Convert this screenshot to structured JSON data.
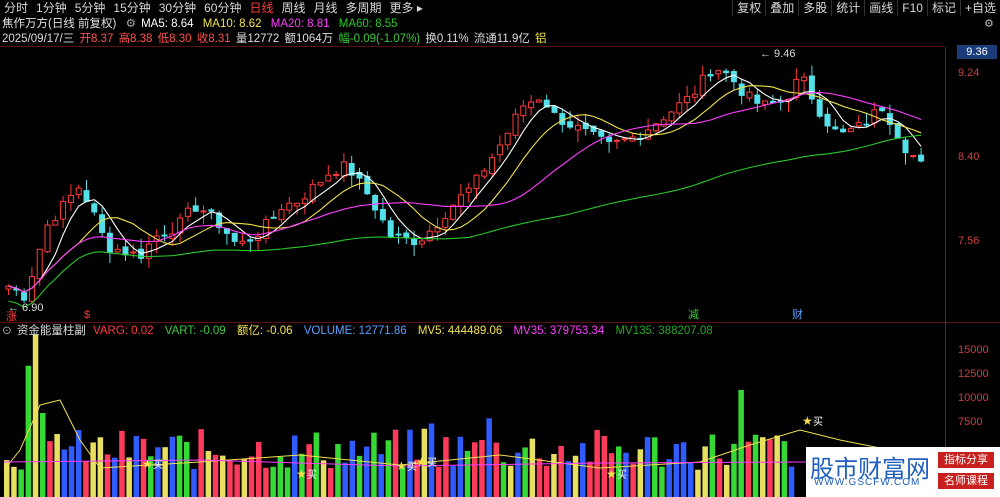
{
  "toolbar": {
    "left": [
      "分时",
      "1分钟",
      "5分钟",
      "15分钟",
      "30分钟",
      "60分钟",
      "日线",
      "周线",
      "月线",
      "多周期",
      "更多"
    ],
    "active_index": 6,
    "right": [
      "复权",
      "叠加",
      "多股",
      "统计",
      "画线",
      "F10",
      "标记",
      "+自选"
    ]
  },
  "stock": {
    "name": "焦作万方(日线 前复权)",
    "ma_labels": [
      "MA5: 8.64",
      "MA10: 8.62",
      "MA20: 8.81",
      "MA60: 8.55"
    ],
    "ma_colors": [
      "#ffffff",
      "#f1e14b",
      "#ff3cff",
      "#28c828"
    ]
  },
  "ohlc": {
    "date": "2025/09/17/三",
    "open": "开8.37",
    "high": "高8.38",
    "low": "低8.30",
    "close": "收8.31",
    "volume": "量12772",
    "amount": "额1064万",
    "change": "幅-0.09(-1.07%)",
    "turnover": "换0.11%",
    "float": "流通11.9亿",
    "sector": "铝"
  },
  "price_axis": [
    "9.24",
    "8.40",
    "7.56"
  ],
  "current_price": "9.36",
  "annotations": {
    "high": "9.46",
    "low": "6.90",
    "mark1": "涨",
    "mark2": "$",
    "mark3": "减",
    "mark4": "财"
  },
  "volume_panel": {
    "title": "资金能量柱副",
    "varg": "VARG: 0.02",
    "vart": "VART: -0.09",
    "amount": "额亿: -0.06",
    "volume": "VOLUME: 12771.86",
    "mv5": "MV5: 444489.06",
    "mv35": "MV35: 379753.34",
    "mv135": "MV135: 388207.08",
    "axis": [
      "15000",
      "12500",
      "10000",
      "7500"
    ],
    "signal_label": "买"
  },
  "watermark": {
    "title": "股市财富网",
    "url": "WWW.GSCFW.COM",
    "tag1": "指标分享",
    "tag2": "名师课程"
  }
}
